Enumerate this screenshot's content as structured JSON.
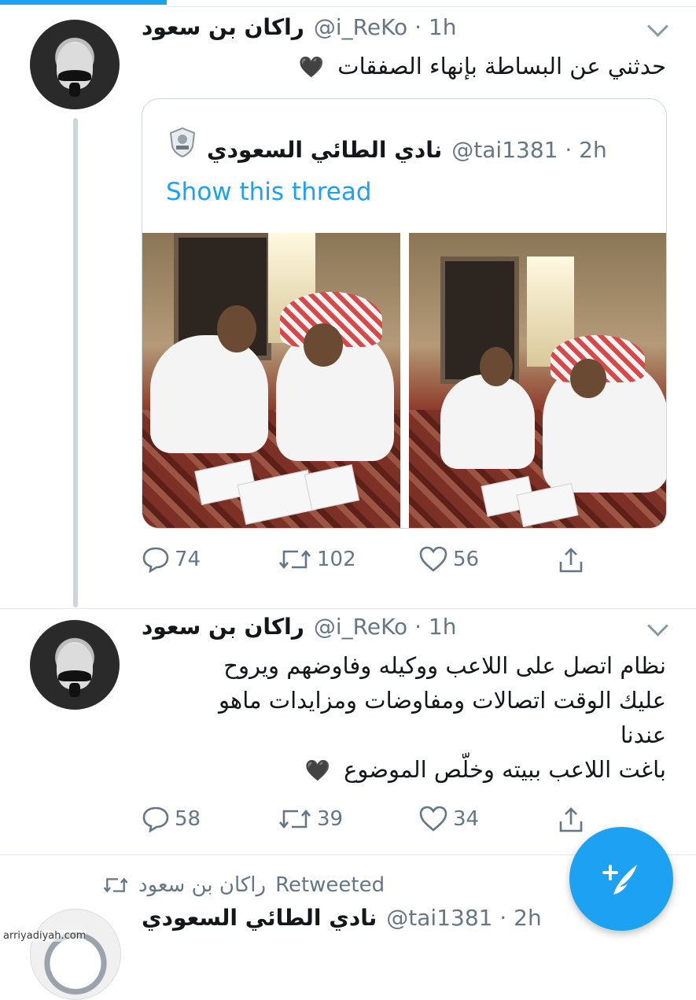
{
  "tweet1": {
    "name": "راكان بن سعود",
    "handle": "@i_ReKo · 1h",
    "text": "حدثني عن البساطة بإنهاء الصفقات",
    "emoji": "🖤",
    "quote": {
      "name": "نادي الطائي السعودي",
      "handle": "@tai1381 · 2h",
      "show_thread": "Show this thread"
    },
    "replies": "74",
    "retweets": "102",
    "likes": "56"
  },
  "tweet2": {
    "name": "راكان بن سعود",
    "handle": "@i_ReKo · 1h",
    "lines": [
      "نظام اتصل على اللاعب ووكيله وفاوضهم ويروح",
      "عليك الوقت اتصالات ومفاوضات ومزايدات ماهو",
      "عندنا",
      "باغت اللاعب ببيته وخلّص الموضوع"
    ],
    "emoji": "🖤",
    "replies": "58",
    "retweets": "39",
    "likes": "34"
  },
  "tweet3": {
    "retweeted_by": "راكان بن سعود",
    "retweeted_label": "Retweeted",
    "name": "نادي الطائي السعودي",
    "handle": "@tai1381 · 2h"
  },
  "icons": {
    "reply": "reply-icon",
    "retweet": "retweet-icon",
    "like": "heart-icon",
    "share": "share-icon",
    "compose": "compose-tweet-icon",
    "caret": "chevron-down-icon"
  },
  "colors": {
    "accent": "#1da1f2",
    "secondary_text": "#657786",
    "border": "#ccd6dd"
  },
  "watermark": "arriyadiyah.com"
}
